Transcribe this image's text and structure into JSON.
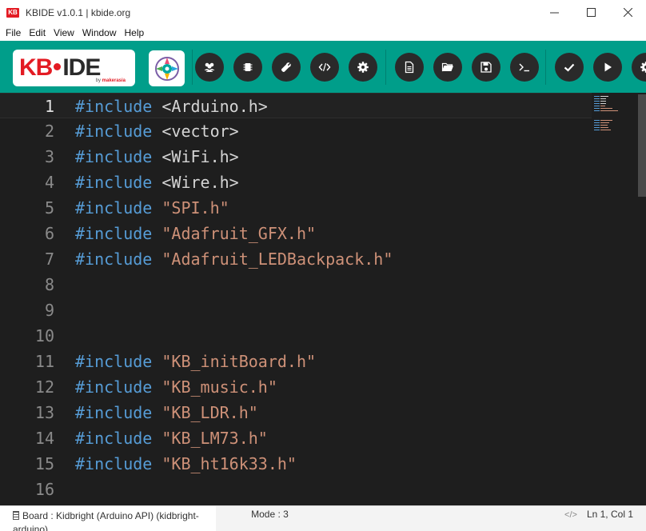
{
  "window": {
    "app_icon_label": "KB",
    "title": "KBIDE v1.0.1 | kbide.org",
    "icon_names": [
      "minimize-icon",
      "maximize-icon",
      "close-icon"
    ]
  },
  "menu": [
    "File",
    "Edit",
    "View",
    "Window",
    "Help"
  ],
  "toolbar": {
    "logo_kb": "KB",
    "logo_ide": "IDE",
    "logo_by": "by",
    "logo_maker": "makerasia",
    "buttons": [
      {
        "name": "plugins-button",
        "icon": "users-icon"
      },
      {
        "name": "board-button",
        "icon": "chip-icon"
      },
      {
        "name": "tools-button",
        "icon": "wrench-icon"
      },
      {
        "name": "code-view-button",
        "icon": "code-icon"
      },
      {
        "name": "settings-button",
        "icon": "gear-icon"
      },
      {
        "name": "new-file-button",
        "icon": "file-icon"
      },
      {
        "name": "open-folder-button",
        "icon": "folder-icon"
      },
      {
        "name": "save-button",
        "icon": "save-icon"
      },
      {
        "name": "serial-monitor-button",
        "icon": "terminal-icon"
      },
      {
        "name": "compile-button",
        "icon": "check-icon"
      },
      {
        "name": "upload-button",
        "icon": "play-icon"
      },
      {
        "name": "extra-settings-button",
        "icon": "gear-icon"
      }
    ],
    "accent_color": "#009e8a"
  },
  "editor": {
    "active_line": 1,
    "lines": [
      {
        "n": "1",
        "kw": "#include",
        "arg": "<Arduino.h>",
        "kind": "sys"
      },
      {
        "n": "2",
        "kw": "#include",
        "arg": "<vector>",
        "kind": "sys"
      },
      {
        "n": "3",
        "kw": "#include",
        "arg": "<WiFi.h>",
        "kind": "sys"
      },
      {
        "n": "4",
        "kw": "#include",
        "arg": "<Wire.h>",
        "kind": "sys"
      },
      {
        "n": "5",
        "kw": "#include",
        "arg": "\"SPI.h\"",
        "kind": "str"
      },
      {
        "n": "6",
        "kw": "#include",
        "arg": "\"Adafruit_GFX.h\"",
        "kind": "str"
      },
      {
        "n": "7",
        "kw": "#include",
        "arg": "\"Adafruit_LEDBackpack.h\"",
        "kind": "str"
      },
      {
        "n": "8",
        "kw": "",
        "arg": "",
        "kind": "empty"
      },
      {
        "n": "9",
        "kw": "",
        "arg": "",
        "kind": "empty"
      },
      {
        "n": "10",
        "kw": "",
        "arg": "",
        "kind": "empty"
      },
      {
        "n": "11",
        "kw": "#include",
        "arg": "\"KB_initBoard.h\"",
        "kind": "str"
      },
      {
        "n": "12",
        "kw": "#include",
        "arg": "\"KB_music.h\"",
        "kind": "str"
      },
      {
        "n": "13",
        "kw": "#include",
        "arg": "\"KB_LDR.h\"",
        "kind": "str"
      },
      {
        "n": "14",
        "kw": "#include",
        "arg": "\"KB_LM73.h\"",
        "kind": "str"
      },
      {
        "n": "15",
        "kw": "#include",
        "arg": "\"KB_ht16k33.h\"",
        "kind": "str"
      },
      {
        "n": "16",
        "kw": "",
        "arg": "",
        "kind": "empty"
      }
    ],
    "colors": {
      "keyword": "#569cd6",
      "string": "#ce9178",
      "angle": "#d4d4d4",
      "background": "#1e1e1e"
    }
  },
  "status": {
    "board": "Board : Kidbright (Arduino API) (kidbright-arduino)",
    "mode": "Mode : 3",
    "position": "Ln 1, Col 1"
  }
}
